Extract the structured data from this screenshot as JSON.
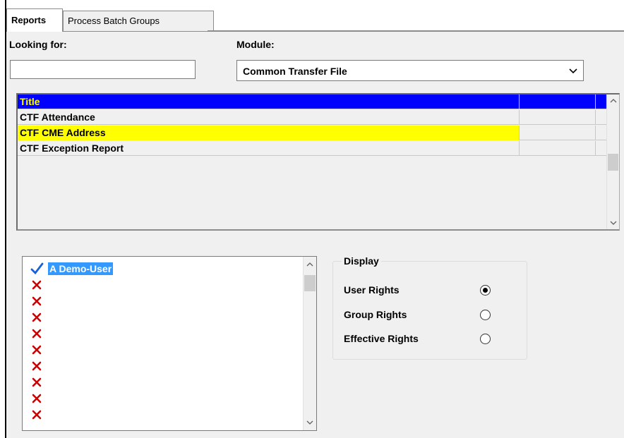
{
  "tabs": [
    {
      "label": "Reports",
      "active": true
    },
    {
      "label": "Process Batch Groups",
      "active": false
    }
  ],
  "search": {
    "label": "Looking for:",
    "value": ""
  },
  "module": {
    "label": "Module:",
    "selected": "Common Transfer File"
  },
  "reports_grid": {
    "header": "Title",
    "rows": [
      {
        "title": "CTF Attendance",
        "highlighted": false
      },
      {
        "title": "CTF CME Address",
        "highlighted": true
      },
      {
        "title": "CTF Exception Report",
        "highlighted": false
      }
    ]
  },
  "users": [
    {
      "name": "A Demo-User",
      "icon": "checkmark-icon"
    },
    {
      "name": "",
      "icon": "cross-icon"
    },
    {
      "name": "",
      "icon": "cross-icon"
    },
    {
      "name": "",
      "icon": "cross-icon"
    },
    {
      "name": "",
      "icon": "cross-icon"
    },
    {
      "name": "",
      "icon": "cross-icon"
    },
    {
      "name": "",
      "icon": "cross-icon"
    },
    {
      "name": "",
      "icon": "cross-icon"
    },
    {
      "name": "",
      "icon": "cross-icon"
    },
    {
      "name": "",
      "icon": "cross-icon"
    }
  ],
  "display": {
    "legend": "Display",
    "options": [
      {
        "label": "User Rights",
        "selected": true
      },
      {
        "label": "Group Rights",
        "selected": false
      },
      {
        "label": "Effective Rights",
        "selected": false
      }
    ]
  },
  "colors": {
    "grid_header_bg": "#0000ff",
    "grid_header_text": "#ffff00",
    "highlight_row": "#ffff00",
    "selection": "#3399ff",
    "check": "#1a5fd6",
    "cross": "#cc0000"
  }
}
